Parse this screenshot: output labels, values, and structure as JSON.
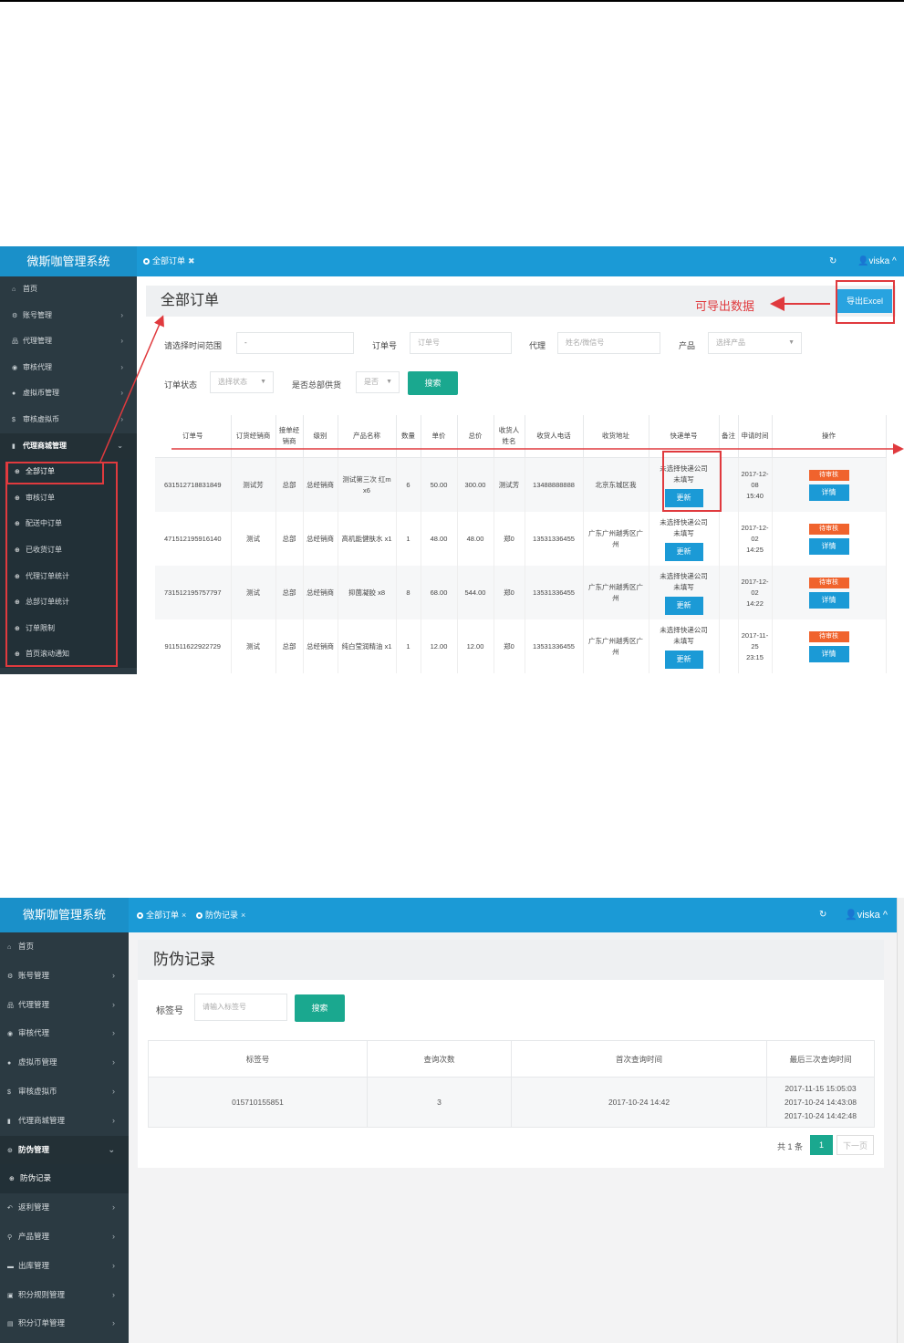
{
  "shot1": {
    "brand": "微斯咖管理系统",
    "tab_label": "全部订单",
    "refresh_icon": "↻",
    "user": "viska",
    "sidebar": {
      "items": [
        {
          "icon": "home-icon",
          "label": "首页"
        },
        {
          "icon": "gears-icon",
          "label": "账号管理"
        },
        {
          "icon": "sitemap-icon",
          "label": "代理管理"
        },
        {
          "icon": "eye-icon",
          "label": "审核代理"
        },
        {
          "icon": "coin-icon",
          "label": "虚拟币管理"
        },
        {
          "icon": "dollar-icon",
          "label": "审核虚拟币"
        },
        {
          "icon": "file-icon",
          "label": "代理商城管理"
        }
      ],
      "sub_items": [
        "全部订单",
        "审核订单",
        "配送中订单",
        "已收货订单",
        "代理订单统计",
        "总部订单统计",
        "订单限制",
        "首页滚动通知"
      ]
    },
    "page_title": "全部订单",
    "export_label": "导出Excel",
    "annotation": "可导出数据",
    "filters": {
      "time_label": "请选择时间范围",
      "time_value": "-",
      "order_no_label": "订单号",
      "order_no_placeholder": "订单号",
      "agent_label": "代理",
      "agent_placeholder": "姓名/微信号",
      "product_label": "产品",
      "product_placeholder": "选择产品",
      "status_label": "订单状态",
      "status_placeholder": "选择状态",
      "hq_label": "是否总部供货",
      "hq_placeholder": "是否",
      "search_label": "搜索"
    },
    "columns": [
      "订单号",
      "订货经销商",
      "接单经销商",
      "级别",
      "产品名称",
      "数量",
      "单价",
      "总价",
      "收货人姓名",
      "收货人电话",
      "收货地址",
      "快递单号",
      "备注",
      "申请时间",
      "操作"
    ],
    "rows": [
      {
        "order": "631512718831849",
        "buyer": "测试芳",
        "seller": "总部",
        "level": "总经销商",
        "product": "测试第三次 红m x6",
        "qty": "6",
        "price": "50.00",
        "total": "300.00",
        "receiver": "测试芳",
        "phone": "13488888888",
        "address": "北京东城区我",
        "express": "未选择快递公司",
        "express_no": "未填写",
        "update": "更新",
        "note": "",
        "date": "2017-12-08",
        "time": "15:40",
        "status": "待审核",
        "detail": "详情"
      },
      {
        "order": "471512195916140",
        "buyer": "测试",
        "seller": "总部",
        "level": "总经销商",
        "product": "高机能健肤水 x1",
        "qty": "1",
        "price": "48.00",
        "total": "48.00",
        "receiver": "郑0",
        "phone": "13531336455",
        "address": "广东广州越秀区广州",
        "express": "未选择快递公司",
        "express_no": "未填写",
        "update": "更新",
        "note": "",
        "date": "2017-12-02",
        "time": "14:25",
        "status": "待审核",
        "detail": "详情"
      },
      {
        "order": "731512195757797",
        "buyer": "测试",
        "seller": "总部",
        "level": "总经销商",
        "product": "抑菌凝胶 x8",
        "qty": "8",
        "price": "68.00",
        "total": "544.00",
        "receiver": "郑0",
        "phone": "13531336455",
        "address": "广东广州越秀区广州",
        "express": "未选择快递公司",
        "express_no": "未填写",
        "update": "更新",
        "note": "",
        "date": "2017-12-02",
        "time": "14:22",
        "status": "待审核",
        "detail": "详情"
      },
      {
        "order": "911511622922729",
        "buyer": "测试",
        "seller": "总部",
        "level": "总经销商",
        "product": "纯白莹润精油 x1",
        "qty": "1",
        "price": "12.00",
        "total": "12.00",
        "receiver": "郑0",
        "phone": "13531336455",
        "address": "广东广州越秀区广州",
        "express": "未选择快递公司",
        "express_no": "未填写",
        "update": "更新",
        "note": "",
        "date": "2017-11-25",
        "time": "23:15",
        "status": "待审核",
        "detail": "详情"
      }
    ]
  },
  "shot2": {
    "brand": "微斯咖管理系统",
    "tabs": [
      "全部订单",
      "防伪记录"
    ],
    "user": "viska",
    "sidebar": [
      {
        "icon": "home-icon",
        "label": "首页",
        "chev": ""
      },
      {
        "icon": "gears-icon",
        "label": "账号管理",
        "chev": "›"
      },
      {
        "icon": "sitemap-icon",
        "label": "代理管理",
        "chev": "›"
      },
      {
        "icon": "eye-icon",
        "label": "审核代理",
        "chev": "›"
      },
      {
        "icon": "coin-icon",
        "label": "虚拟币管理",
        "chev": "›"
      },
      {
        "icon": "dollar-icon",
        "label": "审核虚拟币",
        "chev": "›"
      },
      {
        "icon": "file-icon",
        "label": "代理商城管理",
        "chev": "›"
      },
      {
        "icon": "shield-icon",
        "label": "防伪管理",
        "chev": "⌄"
      },
      {
        "icon": "circle-plus-icon",
        "label": "防伪记录",
        "chev": ""
      },
      {
        "icon": "reply-icon",
        "label": "返利管理",
        "chev": "›"
      },
      {
        "icon": "search-icon",
        "label": "产品管理",
        "chev": "›"
      },
      {
        "icon": "box-icon",
        "label": "出库管理",
        "chev": "›"
      },
      {
        "icon": "screen-icon",
        "label": "积分规则管理",
        "chev": "›"
      },
      {
        "icon": "doc-icon",
        "label": "积分订单管理",
        "chev": "›"
      }
    ],
    "page_title": "防伪记录",
    "tag_label": "标签号",
    "tag_placeholder": "请输入标签号",
    "search_label": "搜索",
    "columns": [
      "标签号",
      "查询次数",
      "首次查询时间",
      "最后三次查询时间"
    ],
    "row": {
      "tag": "015710155851",
      "count": "3",
      "first": "2017-10-24 14:42",
      "last": [
        "2017-11-15 15:05:03",
        "2017-10-24 14:43:08",
        "2017-10-24 14:42:48"
      ]
    },
    "pager": {
      "total": "共 1 条",
      "page": "1",
      "next": "下一页"
    }
  }
}
